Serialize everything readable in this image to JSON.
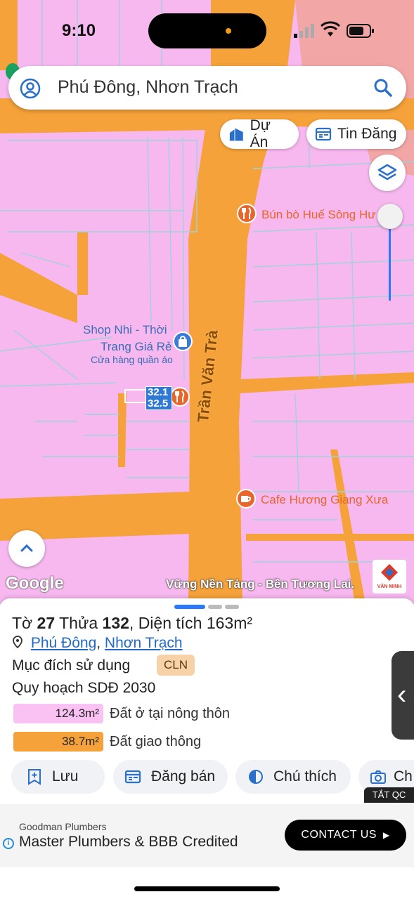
{
  "status": {
    "time": "9:10"
  },
  "search": {
    "query": "Phú Đông, Nhơn Trạch"
  },
  "chips": [
    {
      "label": "Dự Án",
      "icon": "building-icon"
    },
    {
      "label": "Tin Đăng",
      "icon": "listing-icon"
    }
  ],
  "map": {
    "pois": [
      {
        "name": "Bún bò Huế Sông Hư",
        "icon": "fork-knife-icon"
      },
      {
        "name_line1": "Shop Nhi - Thời",
        "name_line2": "Trang Giá Rẻ",
        "category": "Cửa hàng quần áo",
        "icon": "shopping-bag-icon"
      },
      {
        "name": "Cafe Hương Giang Xưa",
        "icon": "coffee-icon"
      }
    ],
    "road": "Trần Văn Trà",
    "plot_label": {
      "line1": "32.1",
      "line2": "32.5"
    },
    "attribution": "Google",
    "slogan": "Vững Nền Tảng - Bền Tương Lai.",
    "brand": "VĂN MINH"
  },
  "parcel": {
    "to_label": "Tờ",
    "to": "27",
    "thua_label": "Thửa",
    "thua": "132",
    "area_label": "Diện tích",
    "area": "163m²",
    "ward": "Phú Đông",
    "district": "Nhơn Trạch",
    "purpose_label": "Mục đích sử dụng",
    "purpose_code": "CLN",
    "plan_label": "Quy hoạch SDĐ 2030",
    "zones": [
      {
        "area": "124.3m²",
        "label": "Đất ở tại nông thôn",
        "color": "#f9c2f3"
      },
      {
        "area": "38.7m²",
        "label": "Đất giao thông",
        "color": "#f5a23a"
      }
    ]
  },
  "actions": [
    {
      "label": "Lưu",
      "icon": "bookmark-plus-icon"
    },
    {
      "label": "Đăng bán",
      "icon": "listing-icon"
    },
    {
      "label": "Chú thích",
      "icon": "contrast-icon"
    },
    {
      "label": "Ch",
      "icon": "camera-icon"
    }
  ],
  "ad": {
    "hide_label": "TẮT QC",
    "advertiser": "Goodman Plumbers",
    "headline": "Master Plumbers & BBB Credited",
    "cta": "CONTACT US"
  },
  "colors": {
    "accent": "#2979ff",
    "road": "#f5a23a",
    "residential": "#f7b8ef"
  }
}
